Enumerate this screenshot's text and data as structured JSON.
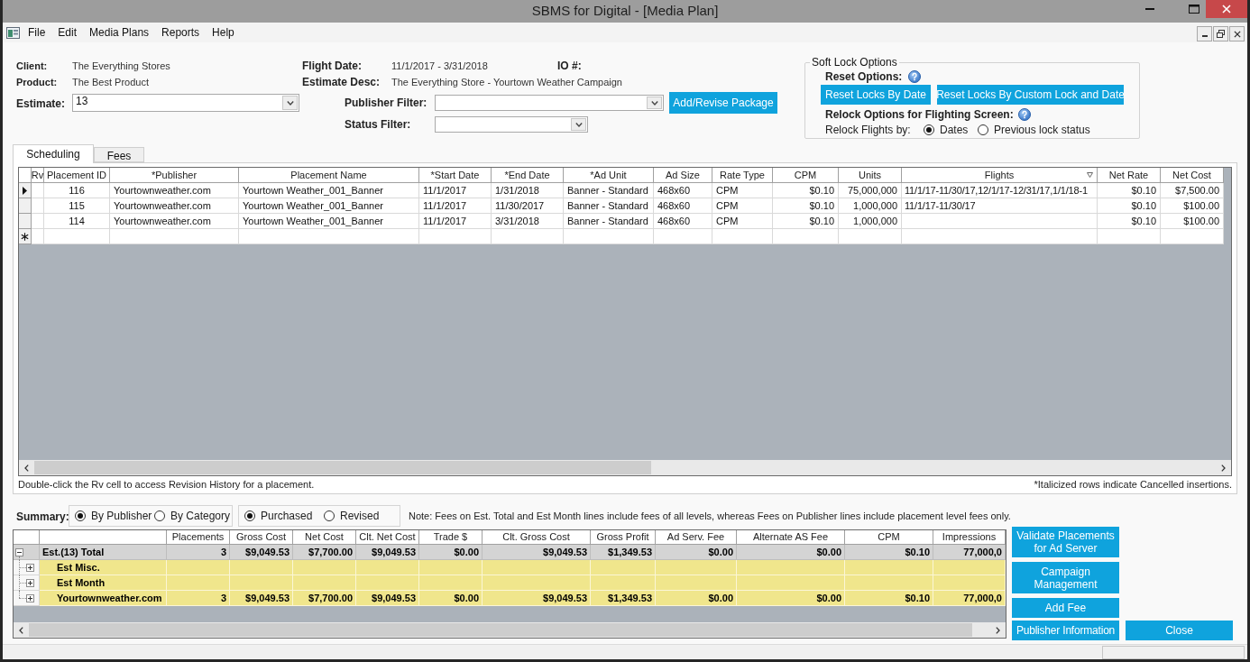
{
  "window": {
    "title": "SBMS for Digital - [Media Plan]"
  },
  "menu": [
    "File",
    "Edit",
    "Media Plans",
    "Reports",
    "Help"
  ],
  "client": {
    "label": "Client:",
    "value": "The Everything Stores"
  },
  "product": {
    "label": "Product:",
    "value": "The Best Product"
  },
  "flight_date": {
    "label": "Flight Date:",
    "value": "11/1/2017 - 3/31/2018"
  },
  "io_number": {
    "label": "IO #:"
  },
  "estimate_desc": {
    "label": "Estimate Desc:",
    "value": "The Everything Store - Yourtown Weather Campaign"
  },
  "estimate": {
    "label": "Estimate:",
    "value": "13"
  },
  "publisher_filter": {
    "label": "Publisher Filter:"
  },
  "status_filter": {
    "label": "Status Filter:"
  },
  "add_revise_button": "Add/Revise Package",
  "soft_lock_options": {
    "title": "Soft Lock Options",
    "reset_label": "Reset Options:",
    "reset_buttons": [
      "Reset Locks By Date",
      "Reset Locks By Custom Lock and Date"
    ],
    "relock_label": "Relock Options for Flighting Screen:",
    "relock_by_label": "Relock Flights by:",
    "relock_by": [
      {
        "label": "Dates",
        "selected": true
      },
      {
        "label": "Previous lock status",
        "selected": false
      }
    ]
  },
  "tabs": [
    {
      "label": "Scheduling",
      "selected": true
    },
    {
      "label": "Fees",
      "selected": false
    }
  ],
  "placements": {
    "columns": [
      {
        "label": "Rv",
        "filtered": false
      },
      {
        "label": "Placement ID",
        "filtered": false
      },
      {
        "label": "*Publisher",
        "filtered": false
      },
      {
        "label": "Placement Name",
        "filtered": false
      },
      {
        "label": "*Start Date",
        "filtered": false
      },
      {
        "label": "*End Date",
        "filtered": false
      },
      {
        "label": "*Ad Unit",
        "filtered": false
      },
      {
        "label": "Ad Size",
        "filtered": false
      },
      {
        "label": "Rate Type",
        "filtered": false
      },
      {
        "label": "CPM",
        "filtered": false
      },
      {
        "label": "Units",
        "filtered": false
      },
      {
        "label": "Flights",
        "filtered": true
      },
      {
        "label": "Net Rate",
        "filtered": false
      },
      {
        "label": "Net Cost",
        "filtered": false
      }
    ],
    "rows": [
      {
        "current": true,
        "placement_id": "116",
        "publisher": "Yourtownweather.com",
        "placement_name": "Yourtown Weather_001_Banner",
        "start_date": "11/1/2017",
        "end_date": "1/31/2018",
        "ad_unit": "Banner - Standard",
        "ad_size": "468x60",
        "rate_type": "CPM",
        "cpm": "$0.10",
        "units": "75,000,000",
        "flights": "11/1/17-11/30/17,12/1/17-12/31/17,1/1/18-1",
        "net_rate": "$0.10",
        "net_cost": "$7,500.00"
      },
      {
        "current": false,
        "placement_id": "115",
        "publisher": "Yourtownweather.com",
        "placement_name": "Yourtown Weather_001_Banner",
        "start_date": "11/1/2017",
        "end_date": "11/30/2017",
        "ad_unit": "Banner - Standard",
        "ad_size": "468x60",
        "rate_type": "CPM",
        "cpm": "$0.10",
        "units": "1,000,000",
        "flights": "11/1/17-11/30/17",
        "net_rate": "$0.10",
        "net_cost": "$100.00"
      },
      {
        "current": false,
        "placement_id": "114",
        "publisher": "Yourtownweather.com",
        "placement_name": "Yourtown Weather_001_Banner",
        "start_date": "11/1/2017",
        "end_date": "3/31/2018",
        "ad_unit": "Banner - Standard",
        "ad_size": "468x60",
        "rate_type": "CPM",
        "cpm": "$0.10",
        "units": "1,000,000",
        "net_rate": "$0.10",
        "net_cost": "$100.00"
      }
    ],
    "hint": "Double-click the Rv cell to access Revision History for a placement.",
    "legend": "*Italicized rows indicate Cancelled insertions."
  },
  "summary": {
    "label": "Summary:",
    "group_by": [
      {
        "label": "By Publisher",
        "selected": true
      },
      {
        "label": "By Category",
        "selected": false
      }
    ],
    "cost_basis": [
      {
        "label": "Purchased",
        "selected": true
      },
      {
        "label": "Revised",
        "selected": false
      }
    ],
    "note": "Note: Fees on Est. Total and Est Month lines include fees of all levels, whereas Fees on Publisher lines include placement level fees only.",
    "columns": [
      "Placements",
      "Gross Cost",
      "Net Cost",
      "Clt. Net Cost",
      "Trade $",
      "Clt. Gross Cost",
      "Gross Profit",
      "Ad Serv. Fee",
      "Alternate AS Fee",
      "CPM",
      "Impressions"
    ],
    "rows": [
      {
        "name": "Est.(13) Total",
        "expanded": true,
        "values": [
          "3",
          "$9,049.53",
          "$7,700.00",
          "$9,049.53",
          "$0.00",
          "$9,049.53",
          "$1,349.53",
          "$0.00",
          "$0.00",
          "$0.10",
          "77,000,0"
        ],
        "children": [
          {
            "name": "Est Misc.",
            "expanded": false
          },
          {
            "name": "Est Month",
            "expanded": false
          },
          {
            "name": "Yourtownweather.com",
            "expanded": false,
            "values": [
              "3",
              "$9,049.53",
              "$7,700.00",
              "$9,049.53",
              "$0.00",
              "$9,049.53",
              "$1,349.53",
              "$0.00",
              "$0.00",
              "$0.10",
              "77,000,0"
            ]
          }
        ]
      }
    ]
  },
  "actions": [
    "Validate Placements for Ad Server",
    "Campaign Management",
    "Add Fee",
    "Publisher Information",
    "Close"
  ]
}
